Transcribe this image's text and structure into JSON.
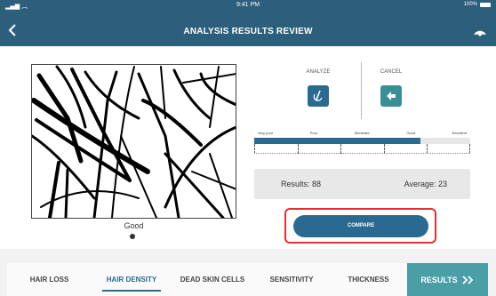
{
  "status_bar": {
    "time": "9:41 PM",
    "battery": "100%"
  },
  "header": {
    "title": "ANALYSIS RESULTS REVIEW"
  },
  "photo": {
    "rating_label": "Good"
  },
  "actions": {
    "analyze_label": "ANALYZE",
    "cancel_label": "CANCEL"
  },
  "scale": {
    "labels": [
      "Very poor",
      "Poor",
      "Moderate",
      "Good",
      "Excellent"
    ],
    "fill_fraction": 0.77,
    "selected": "Good"
  },
  "results": {
    "results_label": "Results:",
    "results_value": "88",
    "average_label": "Average:",
    "average_value": "23"
  },
  "compare": {
    "label": "COMPARE"
  },
  "tabs": [
    {
      "label": "HAIR LOSS"
    },
    {
      "label": "HAIR DENSITY"
    },
    {
      "label": "DEAD SKIN CELLS"
    },
    {
      "label": "SENSITIVITY"
    },
    {
      "label": "THICKNESS"
    },
    {
      "label": "RESULTS"
    }
  ],
  "colors": {
    "header": "#2c5f7c",
    "accent": "#2a6a90",
    "teal": "#3a8e96",
    "highlight": "#e53030"
  }
}
